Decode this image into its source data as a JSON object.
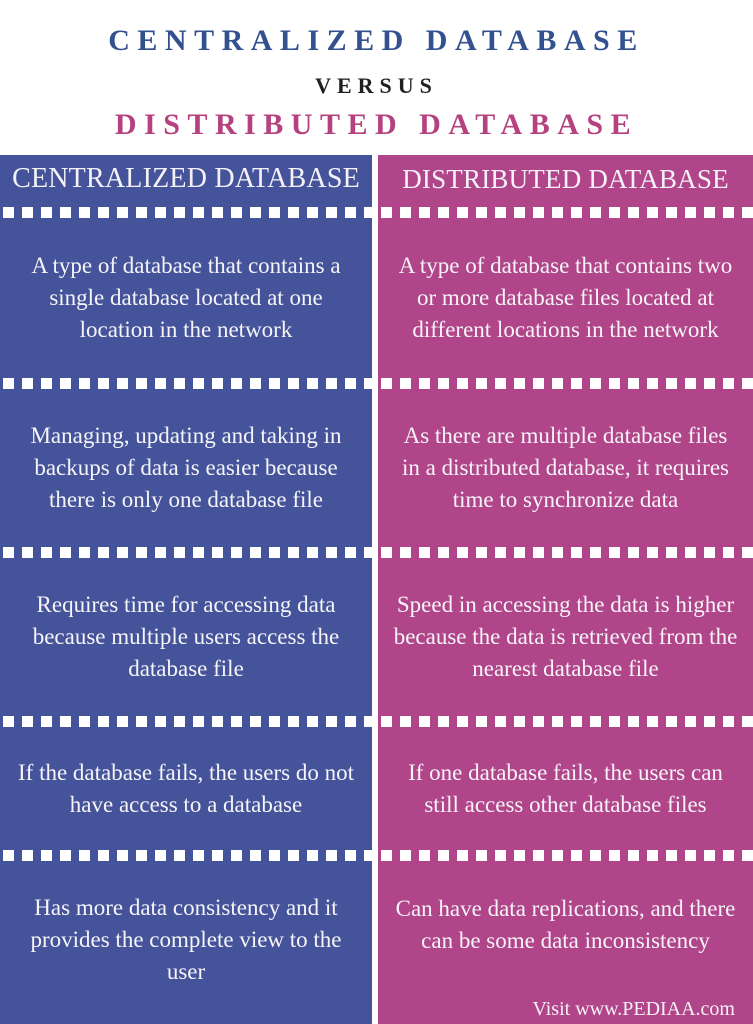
{
  "title": {
    "line1": "CENTRALIZED DATABASE",
    "line2": "VERSUS",
    "line3": "DISTRIBUTED DATABASE"
  },
  "colors": {
    "title_left": "#33508f",
    "title_versus": "#221f1f",
    "title_right": "#b5427e",
    "panel_left": "#45549a",
    "panel_right": "#b1458a",
    "text_on_panel": "#f6f4f8",
    "dash_separator": "#ffffff"
  },
  "columns": [
    {
      "header": "CENTRALIZED DATABASE",
      "rows": [
        "A type of database that contains a single database located at one location in the network",
        "Managing, updating and taking in backups of data is easier because there is only one database file",
        "Requires time for accessing data because multiple users access the database file",
        "If the database fails, the users do not have access to a database",
        "Has more data consistency and it provides the complete view to the user"
      ]
    },
    {
      "header": "DISTRIBUTED DATABASE",
      "rows": [
        "A type of database that contains two or more database files located at different locations in the network",
        "As there are multiple database files in a distributed database, it requires time to synchronize data",
        "Speed in accessing the data is higher because the data is retrieved from the nearest database file",
        "If one database fails, the users can still access other database files",
        "Can have data replications, and there can be some data inconsistency"
      ]
    }
  ],
  "footer": {
    "attribution": "Visit www.PEDIAA.com"
  }
}
